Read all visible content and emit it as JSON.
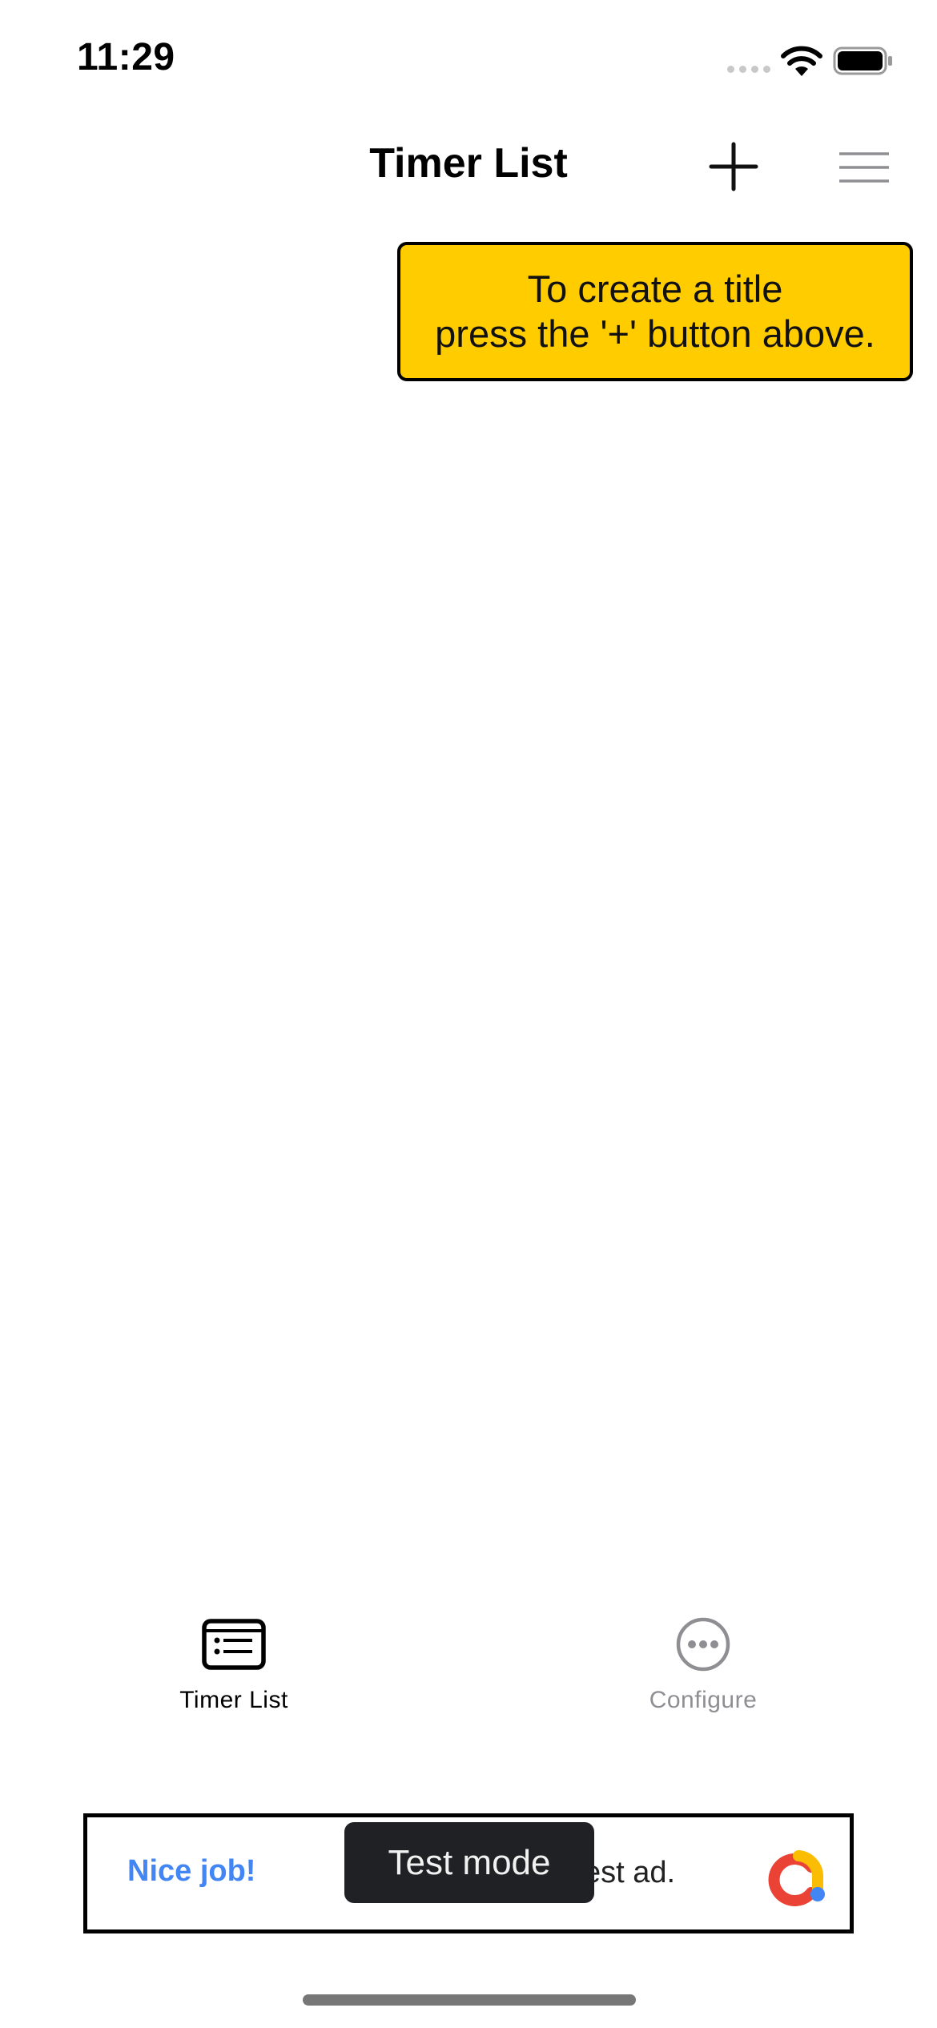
{
  "status_bar": {
    "time": "11:29"
  },
  "nav": {
    "title": "Timer List"
  },
  "tooltip": {
    "line1": "To create a title",
    "line2": "press the '+' button above.",
    "color": "#FFCC00"
  },
  "tabs": [
    {
      "label": "Timer List",
      "icon": "list-card-icon",
      "selected": true,
      "color": "#000000"
    },
    {
      "label": "Configure",
      "icon": "ellipsis-circle-icon",
      "selected": false,
      "color": "#8E8E93"
    }
  ],
  "ad": {
    "headline": "Nice job!",
    "text": "est ad.",
    "badge": "Test mode",
    "headline_color": "#4285F4"
  }
}
